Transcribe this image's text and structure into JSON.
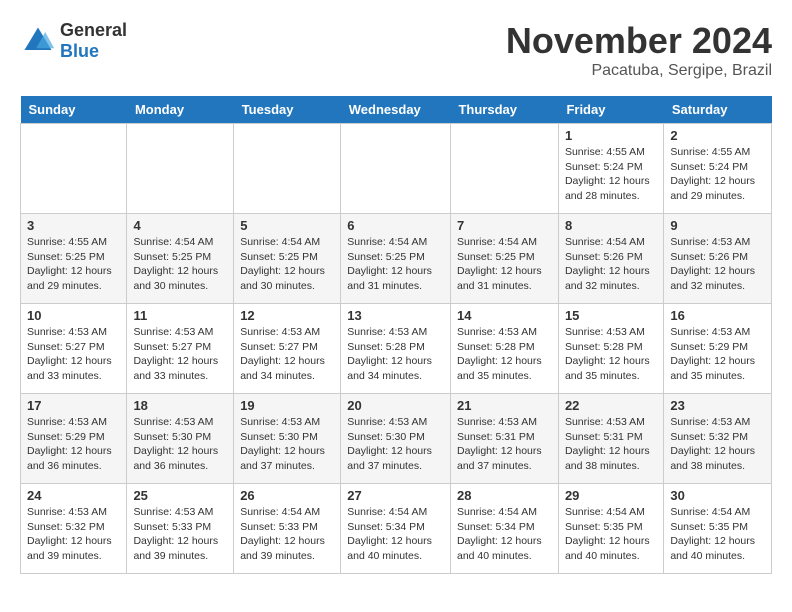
{
  "logo": {
    "general": "General",
    "blue": "Blue"
  },
  "title": "November 2024",
  "location": "Pacatuba, Sergipe, Brazil",
  "weekdays": [
    "Sunday",
    "Monday",
    "Tuesday",
    "Wednesday",
    "Thursday",
    "Friday",
    "Saturday"
  ],
  "weeks": [
    [
      {
        "day": "",
        "info": ""
      },
      {
        "day": "",
        "info": ""
      },
      {
        "day": "",
        "info": ""
      },
      {
        "day": "",
        "info": ""
      },
      {
        "day": "",
        "info": ""
      },
      {
        "day": "1",
        "info": "Sunrise: 4:55 AM\nSunset: 5:24 PM\nDaylight: 12 hours\nand 28 minutes."
      },
      {
        "day": "2",
        "info": "Sunrise: 4:55 AM\nSunset: 5:24 PM\nDaylight: 12 hours\nand 29 minutes."
      }
    ],
    [
      {
        "day": "3",
        "info": "Sunrise: 4:55 AM\nSunset: 5:25 PM\nDaylight: 12 hours\nand 29 minutes."
      },
      {
        "day": "4",
        "info": "Sunrise: 4:54 AM\nSunset: 5:25 PM\nDaylight: 12 hours\nand 30 minutes."
      },
      {
        "day": "5",
        "info": "Sunrise: 4:54 AM\nSunset: 5:25 PM\nDaylight: 12 hours\nand 30 minutes."
      },
      {
        "day": "6",
        "info": "Sunrise: 4:54 AM\nSunset: 5:25 PM\nDaylight: 12 hours\nand 31 minutes."
      },
      {
        "day": "7",
        "info": "Sunrise: 4:54 AM\nSunset: 5:25 PM\nDaylight: 12 hours\nand 31 minutes."
      },
      {
        "day": "8",
        "info": "Sunrise: 4:54 AM\nSunset: 5:26 PM\nDaylight: 12 hours\nand 32 minutes."
      },
      {
        "day": "9",
        "info": "Sunrise: 4:53 AM\nSunset: 5:26 PM\nDaylight: 12 hours\nand 32 minutes."
      }
    ],
    [
      {
        "day": "10",
        "info": "Sunrise: 4:53 AM\nSunset: 5:27 PM\nDaylight: 12 hours\nand 33 minutes."
      },
      {
        "day": "11",
        "info": "Sunrise: 4:53 AM\nSunset: 5:27 PM\nDaylight: 12 hours\nand 33 minutes."
      },
      {
        "day": "12",
        "info": "Sunrise: 4:53 AM\nSunset: 5:27 PM\nDaylight: 12 hours\nand 34 minutes."
      },
      {
        "day": "13",
        "info": "Sunrise: 4:53 AM\nSunset: 5:28 PM\nDaylight: 12 hours\nand 34 minutes."
      },
      {
        "day": "14",
        "info": "Sunrise: 4:53 AM\nSunset: 5:28 PM\nDaylight: 12 hours\nand 35 minutes."
      },
      {
        "day": "15",
        "info": "Sunrise: 4:53 AM\nSunset: 5:28 PM\nDaylight: 12 hours\nand 35 minutes."
      },
      {
        "day": "16",
        "info": "Sunrise: 4:53 AM\nSunset: 5:29 PM\nDaylight: 12 hours\nand 35 minutes."
      }
    ],
    [
      {
        "day": "17",
        "info": "Sunrise: 4:53 AM\nSunset: 5:29 PM\nDaylight: 12 hours\nand 36 minutes."
      },
      {
        "day": "18",
        "info": "Sunrise: 4:53 AM\nSunset: 5:30 PM\nDaylight: 12 hours\nand 36 minutes."
      },
      {
        "day": "19",
        "info": "Sunrise: 4:53 AM\nSunset: 5:30 PM\nDaylight: 12 hours\nand 37 minutes."
      },
      {
        "day": "20",
        "info": "Sunrise: 4:53 AM\nSunset: 5:30 PM\nDaylight: 12 hours\nand 37 minutes."
      },
      {
        "day": "21",
        "info": "Sunrise: 4:53 AM\nSunset: 5:31 PM\nDaylight: 12 hours\nand 37 minutes."
      },
      {
        "day": "22",
        "info": "Sunrise: 4:53 AM\nSunset: 5:31 PM\nDaylight: 12 hours\nand 38 minutes."
      },
      {
        "day": "23",
        "info": "Sunrise: 4:53 AM\nSunset: 5:32 PM\nDaylight: 12 hours\nand 38 minutes."
      }
    ],
    [
      {
        "day": "24",
        "info": "Sunrise: 4:53 AM\nSunset: 5:32 PM\nDaylight: 12 hours\nand 39 minutes."
      },
      {
        "day": "25",
        "info": "Sunrise: 4:53 AM\nSunset: 5:33 PM\nDaylight: 12 hours\nand 39 minutes."
      },
      {
        "day": "26",
        "info": "Sunrise: 4:54 AM\nSunset: 5:33 PM\nDaylight: 12 hours\nand 39 minutes."
      },
      {
        "day": "27",
        "info": "Sunrise: 4:54 AM\nSunset: 5:34 PM\nDaylight: 12 hours\nand 40 minutes."
      },
      {
        "day": "28",
        "info": "Sunrise: 4:54 AM\nSunset: 5:34 PM\nDaylight: 12 hours\nand 40 minutes."
      },
      {
        "day": "29",
        "info": "Sunrise: 4:54 AM\nSunset: 5:35 PM\nDaylight: 12 hours\nand 40 minutes."
      },
      {
        "day": "30",
        "info": "Sunrise: 4:54 AM\nSunset: 5:35 PM\nDaylight: 12 hours\nand 40 minutes."
      }
    ]
  ]
}
